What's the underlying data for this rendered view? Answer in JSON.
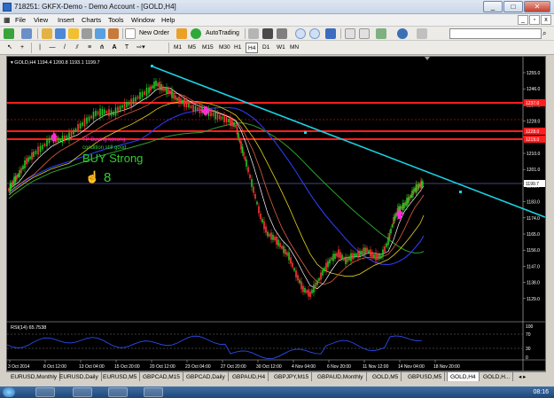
{
  "window": {
    "title": "718251: GKFX-Demo - Demo Account - [GOLD,H4]",
    "minimize": "_",
    "maximize": "□",
    "close": "✕"
  },
  "menu": {
    "items": [
      "File",
      "View",
      "Insert",
      "Charts",
      "Tools",
      "Window",
      "Help"
    ],
    "mdi_buttons": [
      "_",
      "▫",
      "x"
    ]
  },
  "toolbar": {
    "new_order": "New Order",
    "autotrading": "AutoTrading",
    "timeframes": [
      "M1",
      "M5",
      "M15",
      "M30",
      "H1",
      "H4",
      "D1",
      "W1",
      "MN"
    ],
    "active_timeframe": "H4"
  },
  "chart": {
    "symbol_header": "▾ GOLD,H4  1194.4 1200.8 1193.1 1199.7",
    "price_labels": [
      "1255.0",
      "1246.0",
      "1237.0",
      "1228.0",
      "1219.0",
      "1210.0",
      "1201.0",
      "1192.0",
      "1183.0",
      "1174.0",
      "1165.0",
      "1156.0",
      "1147.0",
      "1138.0",
      "1129.0"
    ],
    "marker_labels": [
      "1237.0",
      "1228.0",
      "1219.0",
      "1199.7"
    ],
    "annotations": {
      "line1": "TP Buying kosong",
      "line2": "condition still good",
      "line3": "BUY Strong"
    },
    "rsi_header": "RSI(14) 65.7538",
    "rsi_levels": [
      "100",
      "70",
      "30",
      "0"
    ],
    "time_labels": [
      "3 Oct 2014",
      "8 Oct 12:00",
      "13 Oct 04:00",
      "15 Oct 20:00",
      "20 Oct 12:00",
      "23 Oct 04:00",
      "27 Oct 20:00",
      "30 Oct 12:00",
      "4 Nov 04:00",
      "6 Nov 20:00",
      "11 Nov 12:00",
      "14 Nov 04:00",
      "18 Nov 20:00"
    ],
    "colors": {
      "resistance_red": "#ff1e1e",
      "trendline_cyan": "#19d4e6",
      "up_candle": "#23c823",
      "down_candle": "#ff3838",
      "ma_blue": "#2a3cf0",
      "ma_green": "#2fa02f",
      "ma_yellow": "#e6d21e",
      "annotation_magenta": "#ff2bd6",
      "annotation_green": "#32cd32"
    }
  },
  "tabs": {
    "items": [
      "EURUSD,Monthly",
      "EURUSD,Daily",
      "EURUSD,M5",
      "GBPCAD,M15",
      "GBPCAD,Daily",
      "GBPAUD,H4",
      "GBPJPY,M15",
      "GBPAUD,Monthly",
      "GOLD,M5",
      "GBPUSD,M5",
      "GOLD,H4",
      "GOLD,H..."
    ],
    "active": "GOLD,H4"
  },
  "taskbar": {
    "clock": "08:16"
  }
}
